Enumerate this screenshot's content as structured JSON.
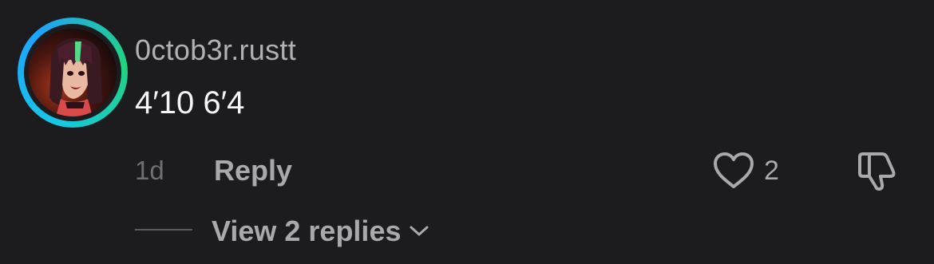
{
  "comment": {
    "username": "0ctob3r.rustt",
    "text": "4′10 6′4",
    "timestamp": "1d",
    "reply_label": "Reply",
    "like_count": "2",
    "view_replies_label": "View 2 replies"
  },
  "icons": {
    "like": "heart-outline-icon",
    "dislike": "thumbs-down-icon",
    "expand": "chevron-down-icon"
  },
  "colors": {
    "background": "#1c1c1e",
    "ring_start": "#16c7e6",
    "ring_end": "#22d37f",
    "username": "#b0b0b5",
    "text": "#f5f5f5",
    "muted": "#a8a8ad"
  }
}
